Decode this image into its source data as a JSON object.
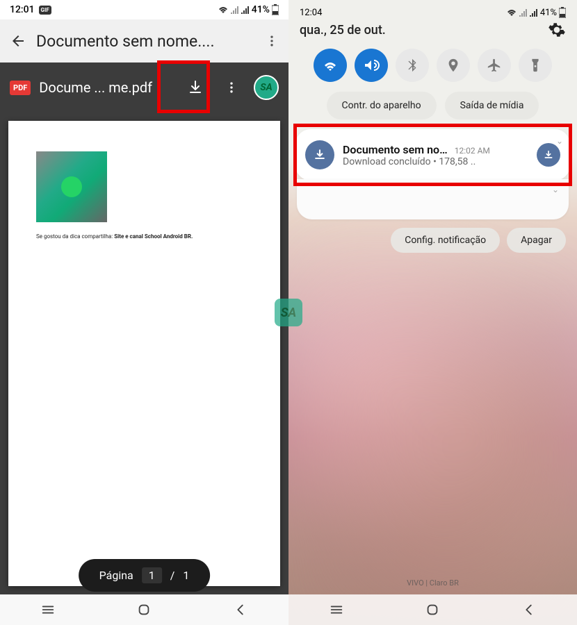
{
  "left": {
    "statusbar": {
      "time": "12:01",
      "battery": "41%"
    },
    "header": {
      "title": "Documento sem nome...."
    },
    "pdf": {
      "badge": "PDF",
      "filename": "Docume ... me.pdf",
      "caption_prefix": "Se gostou da dica compartilha: ",
      "caption_bold": "Site e canal School Android BR."
    },
    "pager": {
      "label": "Página",
      "current": "1",
      "sep": "/",
      "total": "1"
    },
    "avatar": "SA"
  },
  "right": {
    "statusbar": {
      "time": "12:04",
      "battery": "41%"
    },
    "date": "qua., 25 de out.",
    "pills": {
      "device_control": "Contr. do aparelho",
      "media_output": "Saída de mídia"
    },
    "notification": {
      "title": "Documento sem no…",
      "time": "12:02 AM",
      "subtitle": "Download concluído • 178,58 .."
    },
    "actions": {
      "notif_settings": "Config. notificação",
      "clear": "Apagar"
    },
    "carrier": "VIVO | Claro BR"
  },
  "watermark": "SA"
}
